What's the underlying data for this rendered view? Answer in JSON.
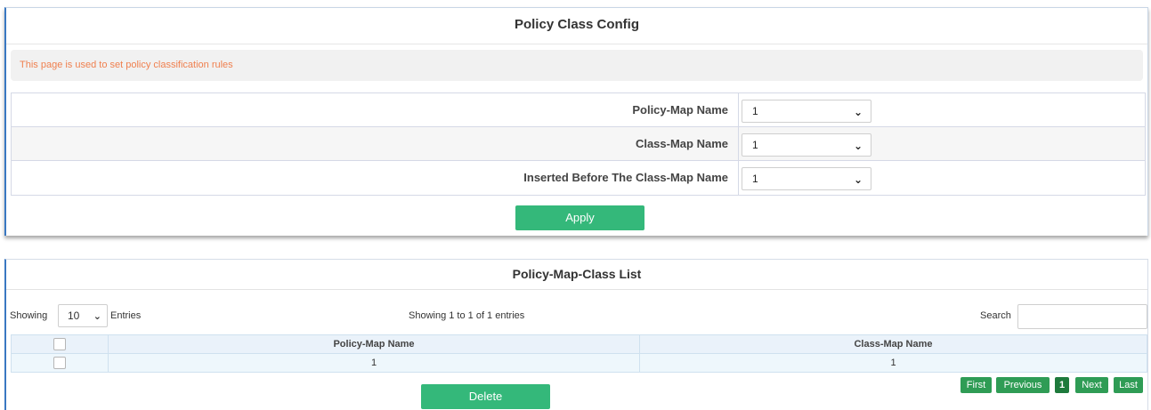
{
  "config": {
    "title": "Policy Class Config",
    "info": "This page is used to set policy classification rules",
    "rows": [
      {
        "label": "Policy-Map Name",
        "value": "1"
      },
      {
        "label": "Class-Map Name",
        "value": "1"
      },
      {
        "label": "Inserted Before The Class-Map Name",
        "value": "1"
      }
    ],
    "apply_label": "Apply"
  },
  "list": {
    "title": "Policy-Map-Class List",
    "showing_label": "Showing",
    "page_size": "10",
    "entries_label": "Entries",
    "info": "Showing 1 to 1 of 1 entries",
    "search_label": "Search",
    "search_value": "",
    "columns": [
      "Policy-Map Name",
      "Class-Map Name"
    ],
    "rows": [
      {
        "policy_map": "1",
        "class_map": "1"
      }
    ],
    "delete_label": "Delete",
    "pager": {
      "first": "First",
      "previous": "Previous",
      "current": "1",
      "next": "Next",
      "last": "Last"
    }
  },
  "colors": {
    "button_green": "#34b87a",
    "pager_green": "#2f9c55",
    "info_text": "#f0804f",
    "panel_accent": "#3a78c2"
  },
  "icons": [
    "chevron-down-icon",
    "checkbox-icon"
  ]
}
